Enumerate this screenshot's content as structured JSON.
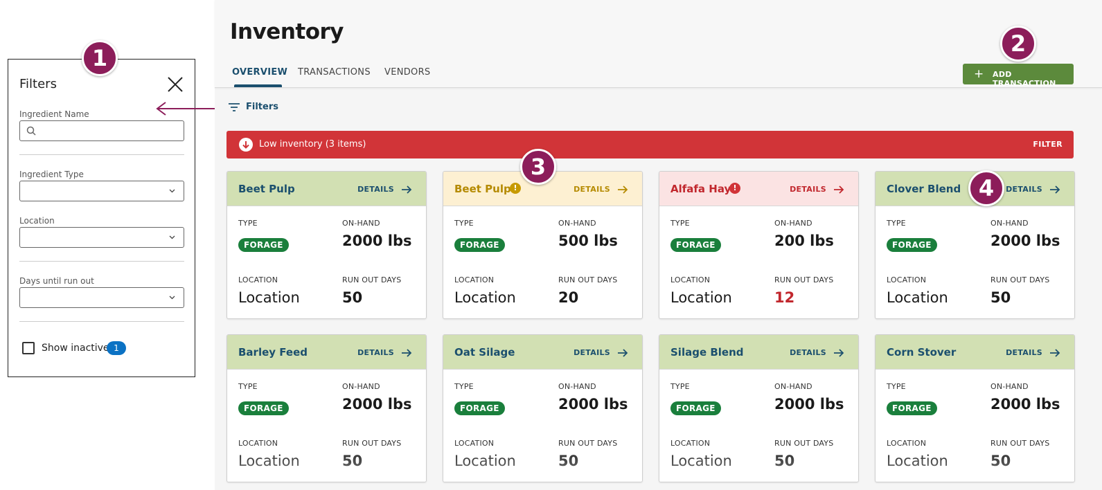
{
  "filters_panel": {
    "title": "Filters",
    "fields": {
      "ingredient_name": {
        "label": "Ingredient Name",
        "value": "",
        "placeholder": ""
      },
      "ingredient_type": {
        "label": "Ingredient Type",
        "value": ""
      },
      "location": {
        "label": "Location",
        "value": ""
      },
      "days_until_run_out": {
        "label": "Days until run out",
        "value": ""
      }
    },
    "show_inactive": {
      "label": "Show inactive",
      "checked": false,
      "count": "1"
    }
  },
  "callouts": [
    "1",
    "2",
    "3",
    "4"
  ],
  "header": {
    "title": "Inventory",
    "tabs": [
      {
        "label": "OVERVIEW",
        "active": true
      },
      {
        "label": "TRANSACTIONS",
        "active": false
      },
      {
        "label": "VENDORS",
        "active": false
      }
    ],
    "add_button_label": "ADD TRANSACTION"
  },
  "filters_link": "Filters",
  "alert": {
    "text": "Low inventory (3 items)",
    "action": "FILTER"
  },
  "card_labels": {
    "type": "TYPE",
    "on_hand": "ON-HAND",
    "location": "LOCATION",
    "run_out": "RUN OUT DAYS",
    "details": "DETAILS"
  },
  "cards": [
    {
      "name": "Beet Pulp",
      "status": "ok",
      "type": "FORAGE",
      "on_hand": "2000 lbs",
      "location": "Location",
      "run_out_days": "50"
    },
    {
      "name": "Beet Pulp",
      "status": "warning",
      "type": "FORAGE",
      "on_hand": "500 lbs",
      "location": "Location",
      "run_out_days": "20"
    },
    {
      "name": "Alfafa Hay",
      "status": "critical",
      "type": "FORAGE",
      "on_hand": "200 lbs",
      "location": "Location",
      "run_out_days": "12"
    },
    {
      "name": "Clover Blend",
      "status": "ok",
      "type": "FORAGE",
      "on_hand": "2000 lbs",
      "location": "Location",
      "run_out_days": "50"
    },
    {
      "name": "Barley Feed",
      "status": "ok",
      "type": "FORAGE",
      "on_hand": "2000 lbs",
      "location": "Location",
      "run_out_days": "50"
    },
    {
      "name": "Oat Silage",
      "status": "ok",
      "type": "FORAGE",
      "on_hand": "2000 lbs",
      "location": "Location",
      "run_out_days": "50"
    },
    {
      "name": "Silage Blend",
      "status": "ok",
      "type": "FORAGE",
      "on_hand": "2000 lbs",
      "location": "Location",
      "run_out_days": "50"
    },
    {
      "name": "Corn Stover",
      "status": "ok",
      "type": "FORAGE",
      "on_hand": "2000 lbs",
      "location": "Location",
      "run_out_days": "50"
    }
  ],
  "colors": {
    "callout": "#8c1d5a",
    "primary_button": "#5c8a3c",
    "alert": "#d13438",
    "tag_forage": "#1a7f3c",
    "card_ok_header": "#d2e0b3",
    "card_warning_header": "#fdf0d2",
    "card_critical_header": "#fbe3e3",
    "link": "#1b4f6e"
  },
  "icons": {
    "close": "close-icon",
    "search": "search-icon",
    "dropdown": "chevron-down-icon",
    "plus": "plus-icon",
    "filter": "filter-lines-icon",
    "alert": "arrow-down-circle-icon",
    "details": "arrow-right-icon",
    "status": "exclamation-icon"
  }
}
